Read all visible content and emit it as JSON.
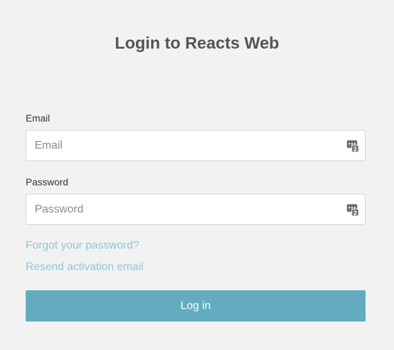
{
  "page": {
    "title": "Login to Reacts Web"
  },
  "form": {
    "email": {
      "label": "Email",
      "placeholder": "Email",
      "value": ""
    },
    "password": {
      "label": "Password",
      "placeholder": "Password",
      "value": ""
    },
    "field_icon": "password-manager-key-icon",
    "links": {
      "forgot_password": "Forgot your password?",
      "resend_activation": "Resend activation email"
    },
    "submit_label": "Log in"
  },
  "colors": {
    "background": "#f2f2f2",
    "title": "#555555",
    "link": "#8ec6d6",
    "button": "#63acc0",
    "button_text": "#ffffff"
  }
}
